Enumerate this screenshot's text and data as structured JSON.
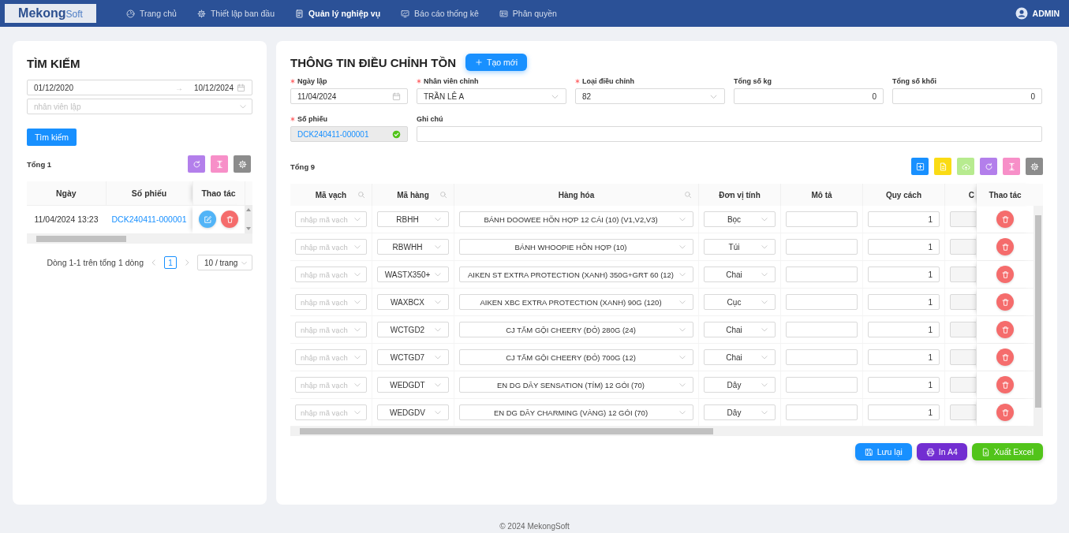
{
  "nav": {
    "logo": {
      "main": "Mekong",
      "sub": "Soft"
    },
    "items": [
      {
        "label": "Trang chủ",
        "selected": false
      },
      {
        "label": "Thiết lập ban đầu",
        "selected": false
      },
      {
        "label": "Quản lý nghiệp vụ",
        "selected": true
      },
      {
        "label": "Báo cáo thống kê",
        "selected": false
      },
      {
        "label": "Phân quyền",
        "selected": false
      }
    ],
    "user": "ADMIN"
  },
  "search_panel": {
    "title": "TÌM KIẾM",
    "date_from": "01/12/2020",
    "range_separator": "→",
    "date_to": "10/12/2024",
    "employee_placeholder": "nhân viên lập",
    "search_button": "Tìm kiếm",
    "total": "Tổng 1",
    "toolbar": [
      {
        "kind": "reload",
        "color": "#b37feb"
      },
      {
        "kind": "height",
        "color": "#f78fc8"
      },
      {
        "kind": "settings",
        "color": "#8c8c8c"
      }
    ],
    "table": {
      "columns": [
        "Ngày",
        "Số phiếu",
        "Thao tác"
      ],
      "rows": [
        {
          "date": "11/04/2024 13:23",
          "code": "DCK240411-000001"
        }
      ]
    },
    "pagination": {
      "summary": "Dòng 1-1 trên tổng 1 dòng",
      "pages": [
        {
          "label": "1",
          "selected": true
        }
      ],
      "page_size": "10 / trang"
    }
  },
  "detail": {
    "title": "THÔNG TIN ĐIỀU CHỈNH TỒN",
    "create_button": "Tạo mới",
    "fields": [
      {
        "label": "Ngày lập",
        "required": true,
        "kind": "date",
        "value": "11/04/2024"
      },
      {
        "label": "Nhân viên chỉnh",
        "required": true,
        "kind": "select",
        "value": "TRẦN LÊ A"
      },
      {
        "label": "Loại điều chỉnh",
        "required": true,
        "kind": "select",
        "value": "82"
      },
      {
        "label": "Tổng số kg",
        "required": false,
        "kind": "number",
        "value": "0"
      },
      {
        "label": "Tổng số khối",
        "required": false,
        "kind": "number",
        "value": "0"
      },
      {
        "label": "Số phiếu",
        "required": true,
        "kind": "code",
        "value": "DCK240411-000001",
        "disabled": true,
        "valid": true
      },
      {
        "label": "Ghi chú",
        "required": false,
        "kind": "text"
      }
    ],
    "total": "Tổng 9",
    "toolbar": [
      {
        "kind": "add",
        "color": "#1890ff"
      },
      {
        "kind": "file",
        "color": "#fadb14"
      },
      {
        "kind": "upload",
        "color": "#b7eb8f"
      },
      {
        "kind": "reload",
        "color": "#b37feb"
      },
      {
        "kind": "height",
        "color": "#f78fc8"
      },
      {
        "kind": "settings",
        "color": "#8c8c8c"
      }
    ],
    "table": {
      "columns": [
        {
          "label": "Mã vạch",
          "searchable": true
        },
        {
          "label": "Mã hàng",
          "searchable": true
        },
        {
          "label": "Hàng hóa",
          "searchable": true
        },
        {
          "label": "Đơn vị tính",
          "searchable": false
        },
        {
          "label": "Mô tả",
          "searchable": false
        },
        {
          "label": "Quy cách",
          "searchable": false
        },
        {
          "label": "C",
          "searchable": false
        },
        {
          "label": "Thao tác",
          "searchable": false
        }
      ],
      "rows": [
        {
          "barcode_placeholder": "nhập mã vạch",
          "code": "RBHH",
          "product": "BÁNH DOOWEE HỖN HỢP 12 CÁI (10) (V1,V2,V3)",
          "unit": "Bọc",
          "spec": "1"
        },
        {
          "barcode_placeholder": "nhập mã vạch",
          "code": "RBWHH",
          "product": "BÁNH WHOOPIE HỖN HỢP (10)",
          "unit": "Túi",
          "spec": "1"
        },
        {
          "barcode_placeholder": "nhập mã vạch",
          "code": "WASTX350+",
          "product": "AIKEN ST EXTRA PROTECTION (XANH) 350G+GRT 60 (12)",
          "unit": "Chai",
          "spec": "1"
        },
        {
          "barcode_placeholder": "nhập mã vạch",
          "code": "WAXBCX",
          "product": "AIKEN XBC EXTRA PROTECTION (XANH) 90G (120)",
          "unit": "Cục",
          "spec": "1"
        },
        {
          "barcode_placeholder": "nhập mã vạch",
          "code": "WCTGD2",
          "product": "CJ TẮM GỘI CHEERY (ĐỎ) 280G (24)",
          "unit": "Chai",
          "spec": "1"
        },
        {
          "barcode_placeholder": "nhập mã vạch",
          "code": "WCTGD7",
          "product": "CJ TẮM GỘI CHEERY (ĐỎ) 700G (12)",
          "unit": "Chai",
          "spec": "1"
        },
        {
          "barcode_placeholder": "nhập mã vạch",
          "code": "WEDGDT",
          "product": "EN DG DÂY SENSATION (TÍM) 12 GÓI (70)",
          "unit": "Dây",
          "spec": "1"
        },
        {
          "barcode_placeholder": "nhập mã vạch",
          "code": "WEDGDV",
          "product": "EN DG DÂY CHARMING (VÀNG) 12 GÓI (70)",
          "unit": "Dây",
          "spec": "1"
        }
      ]
    },
    "actions": [
      {
        "kind": "save",
        "label": "Lưu lại",
        "color": "#1890ff"
      },
      {
        "kind": "print",
        "label": "In A4",
        "color": "#722ed1"
      },
      {
        "kind": "excel",
        "label": "Xuất Excel",
        "color": "#52c41a"
      }
    ]
  },
  "footer": "© 2024 MekongSoft"
}
